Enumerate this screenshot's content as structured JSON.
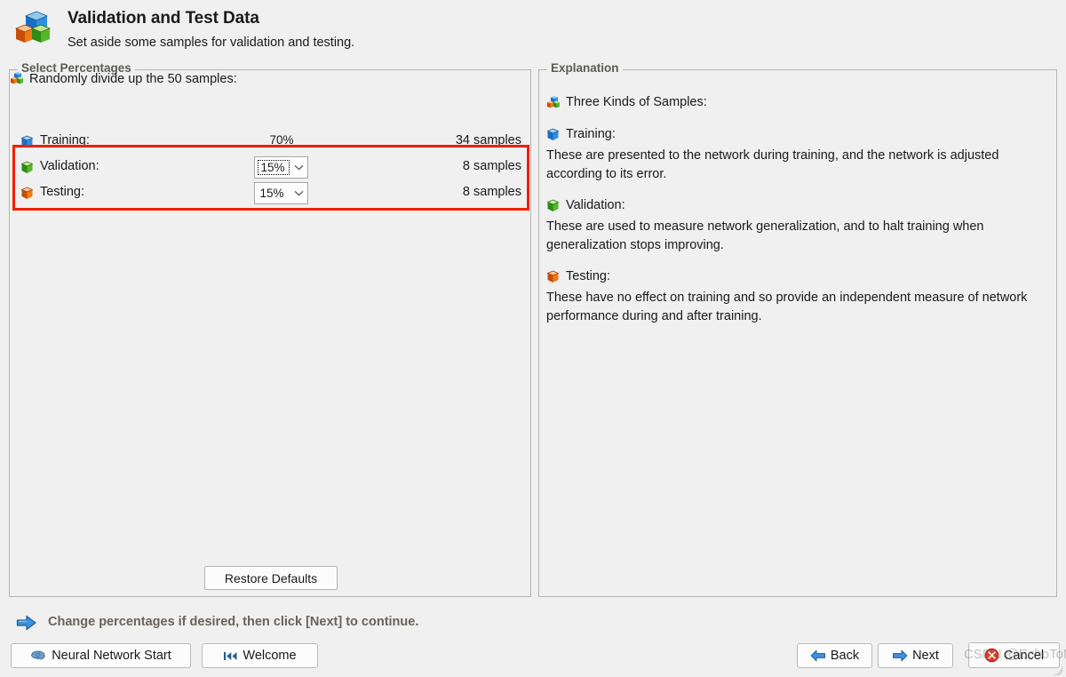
{
  "header": {
    "title": "Validation and Test Data",
    "subtitle": "Set aside some samples for validation and testing.",
    "icon": "cubes-icon"
  },
  "left_panel": {
    "legend": "Select Percentages",
    "divide_icon": "cubes-icon",
    "divide_text": "Randomly divide up the 50 samples:",
    "rows": [
      {
        "icon": "blue-cube-icon",
        "label": "Training:",
        "percent": "70%",
        "editable": false,
        "focused": false,
        "samples": "34 samples"
      },
      {
        "icon": "green-cube-icon",
        "label": "Validation:",
        "percent": "15%",
        "editable": true,
        "focused": true,
        "samples": "8 samples"
      },
      {
        "icon": "orange-cube-icon",
        "label": "Testing:",
        "percent": "15%",
        "editable": true,
        "focused": false,
        "samples": "8 samples"
      }
    ],
    "restore_label": "Restore Defaults"
  },
  "right_panel": {
    "legend": "Explanation",
    "intro_icon": "cubes-icon",
    "intro": "Three Kinds of Samples:",
    "blocks": [
      {
        "icon": "blue-cube-icon",
        "heading": "Training:",
        "text": "These are presented to the network during training, and the network is adjusted according to its error."
      },
      {
        "icon": "green-cube-icon",
        "heading": "Validation:",
        "text": "These are used to measure network generalization, and to halt training when generalization stops improving."
      },
      {
        "icon": "orange-cube-icon",
        "heading": "Testing:",
        "text": "These have no effect on training and so provide an independent measure of network performance during and after training."
      }
    ]
  },
  "footer": {
    "hint_icon": "blue-arrow-right-icon",
    "hint": "Change percentages if desired, then click [Next] to continue.",
    "buttons": {
      "neural_network_start": "Neural Network Start",
      "welcome": "Welcome",
      "back": "Back",
      "next": "Next",
      "cancel": "Cancel"
    }
  },
  "annotation": {
    "highlight_color": "#f02000"
  },
  "watermark": "CSDN @EchoToMe"
}
